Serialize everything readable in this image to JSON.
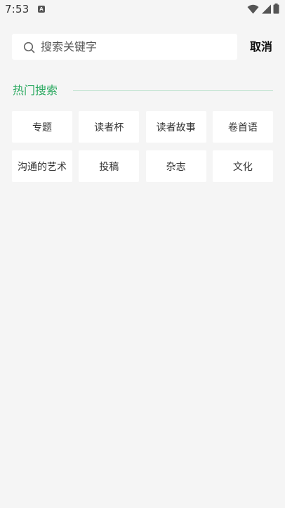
{
  "status_bar": {
    "time": "7:53",
    "notification_icon": "text-a-icon",
    "notification_letter": "A",
    "icons": [
      "wifi-icon",
      "signal-icon",
      "battery-icon"
    ]
  },
  "search": {
    "placeholder": "搜索关键字",
    "value": "",
    "icon": "search-icon",
    "cancel_label": "取消"
  },
  "hot_search": {
    "title": "热门搜索",
    "accent_color": "#2eaa62",
    "tags": [
      {
        "label": "专题"
      },
      {
        "label": "读者杯"
      },
      {
        "label": "读者故事"
      },
      {
        "label": "卷首语"
      },
      {
        "label": "沟通的艺术"
      },
      {
        "label": "投稿"
      },
      {
        "label": "杂志"
      },
      {
        "label": "文化"
      }
    ]
  }
}
